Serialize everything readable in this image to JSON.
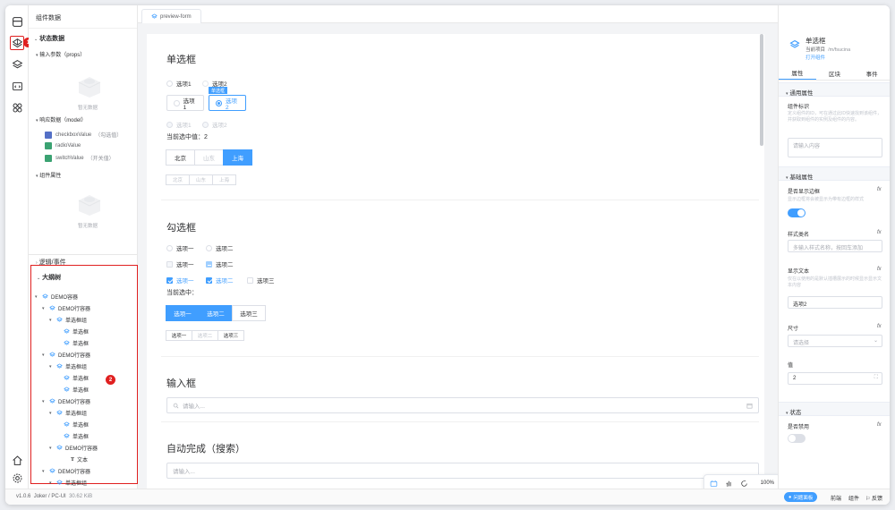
{
  "left_panel": {
    "title": "组件数据",
    "state_section": "状态数据",
    "props_section": "输入参数（props）",
    "empty_text": "暂无数据",
    "model_section": "响应数据（model）",
    "model_items": [
      {
        "name": "checkboxValue",
        "desc": "（勾选值）"
      },
      {
        "name": "radioValue",
        "desc": ""
      },
      {
        "name": "switchValue",
        "desc": "（开关值）"
      }
    ],
    "component_props_section": "组件属性",
    "logic_section": "逻辑/事件",
    "outline_section": "大纲树",
    "tree": [
      {
        "label": "DEMO容器"
      },
      {
        "label": "DEMO行容器"
      },
      {
        "label": "单选框组"
      },
      {
        "label": "单选框"
      },
      {
        "label": "单选框"
      },
      {
        "label": "DEMO行容器"
      },
      {
        "label": "单选框组"
      },
      {
        "label": "单选框"
      },
      {
        "label": "单选框"
      },
      {
        "label": "DEMO行容器"
      },
      {
        "label": "单选框组"
      },
      {
        "label": "单选框"
      },
      {
        "label": "单选框"
      },
      {
        "label": "DEMO行容器"
      },
      {
        "label": "文本"
      },
      {
        "label": "DEMO行容器"
      },
      {
        "label": "单选框组"
      }
    ]
  },
  "rail": {
    "badge1": "1",
    "badge2": "2"
  },
  "tab": {
    "label": "preview-form"
  },
  "canvas": {
    "radio": {
      "title": "单选框",
      "row1": [
        "选项1",
        "选项2"
      ],
      "row2": [
        "选项1",
        "选项2"
      ],
      "selected_tag": "单选框",
      "row3": [
        "选项1",
        "选项2"
      ],
      "current_label": "当前选中值：2",
      "cities": [
        "北京",
        "山东",
        "上海"
      ],
      "cities_small": [
        "北京",
        "山东",
        "上海"
      ]
    },
    "checkbox": {
      "title": "勾选框",
      "row1": [
        "选项一",
        "选项二"
      ],
      "row2": [
        "选项一",
        "选项二"
      ],
      "row3": [
        "选项一",
        "选项二",
        "选项三"
      ],
      "current_label": "当前选中：",
      "buttons": [
        "选项一",
        "选项二",
        "选项三"
      ],
      "small": [
        "选项一",
        "选项二",
        "选项三"
      ]
    },
    "input": {
      "title": "输入框",
      "placeholder": "请输入..."
    },
    "autocomplete": {
      "title": "自动完成（搜索）",
      "placeholder": "请输入..."
    }
  },
  "floatbar": {
    "zoom": "100%"
  },
  "right_panel": {
    "component_name": "单选框",
    "project_label": "当前项目",
    "project_path": "/m/fsucina",
    "open_link": "打开组件",
    "tabs": [
      "属性",
      "区块",
      "事件"
    ],
    "general_section": "通用属性",
    "id_label": "组件标识",
    "id_desc": "定义组件的ID，可在通过此ID快速找到该组件，并获取到组件的实例及组件的内容。",
    "id_placeholder": "请输入内容",
    "basic_section": "基础属性",
    "border_label": "是否显示边框",
    "border_desc": "显示边框将会被显示为带有边框的样式",
    "border_on": true,
    "class_label": "样式类名",
    "class_placeholder": "多输入样式名称，按回车添加",
    "text_label": "显示文本",
    "text_desc": "仅在以使用的是默认插槽展示的时候显示显示文本内容",
    "text_value": "选项2",
    "size_label": "尺寸",
    "size_placeholder": "请选择",
    "value_label": "值",
    "value_value": "2",
    "state_section": "状态",
    "disabled_label": "是否禁用",
    "disabled_on": false,
    "fx": "fx"
  },
  "statusbar": {
    "version": "v1.0.6",
    "app": "Joker / PC-UI",
    "size": "30.62 KiB",
    "btn": "问题面板",
    "links": [
      "前端",
      "组件",
      "反馈"
    ]
  }
}
